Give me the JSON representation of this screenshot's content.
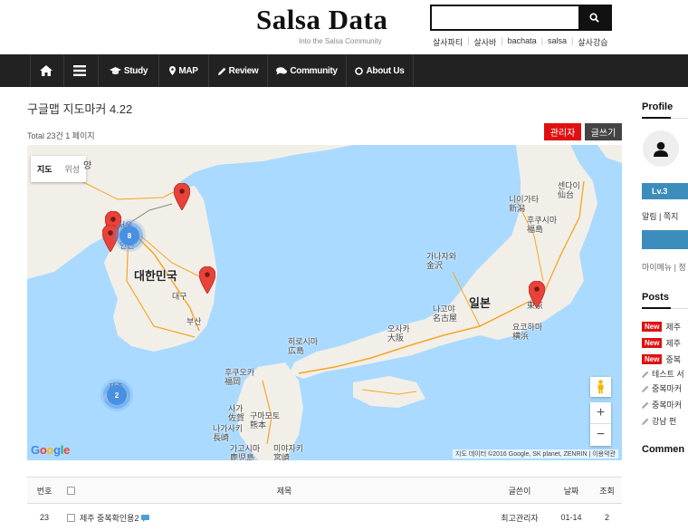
{
  "header": {
    "logo": "Salsa Data",
    "tagline": "Into the Salsa Community",
    "search_placeholder": "",
    "quick_links": [
      "살사파티",
      "살사바",
      "bachata",
      "salsa",
      "살사강습"
    ]
  },
  "nav": {
    "items": [
      {
        "label": "",
        "icon": "home-icon"
      },
      {
        "label": "",
        "icon": "menu-icon"
      },
      {
        "label": "Study",
        "icon": "graduation-cap-icon"
      },
      {
        "label": "MAP",
        "icon": "map-marker-icon"
      },
      {
        "label": "Review",
        "icon": "pencil-icon"
      },
      {
        "label": "Community",
        "icon": "comments-icon"
      },
      {
        "label": "About Us",
        "icon": "circle-icon"
      }
    ]
  },
  "board": {
    "title": "구글맵 지도마커 4.22",
    "total": "Total 23건 1 페이지",
    "admin_button": "관리자",
    "write_button": "글쓰기"
  },
  "map": {
    "type_map": "지도",
    "type_satellite": "위성",
    "labels": {
      "korea": "대한민국",
      "japan": "일본",
      "daegu": "대구",
      "busan": "부산",
      "seoul": "서울",
      "incheon": "인천",
      "jeju": "제주",
      "niigata": "니이가타\n新潟",
      "sendai": "센다이\n仙台",
      "fukushima": "후쿠시마\n福島",
      "kanazawa": "가나자와\n金沢",
      "nagoya": "나고야\n名古屋",
      "osaka": "오사카\n大阪",
      "tokyo": "東京",
      "yokohama": "요코하마\n横浜",
      "hiroshima": "히로시마\n広島",
      "fukuoka": "후쿠오카\n福岡",
      "saga": "사가\n佐賀",
      "kumamoto": "구마모토\n熊本",
      "nagasaki": "나가사키\n長崎",
      "kagoshima": "가고시마\n鹿児島",
      "miyazaki": "미야자키\n宮崎",
      "pyongyang": "양"
    },
    "clusters": [
      {
        "label": "8"
      },
      {
        "label": "2"
      }
    ],
    "attribution": "지도 데이터 ©2016 Google, SK planet, ZENRIN | 이용약관",
    "google_logo": "Google",
    "zoom_in": "+",
    "zoom_out": "−",
    "colors": {
      "sea": "#aadaff",
      "land": "#f2efe9",
      "road": "#f5a623",
      "marker": "#e8423a",
      "cluster": "#4a90e2"
    }
  },
  "table": {
    "headers": {
      "num": "번호",
      "title": "제목",
      "author": "글쓴이",
      "date": "날짜",
      "views": "조회"
    },
    "rows": [
      {
        "num": "23",
        "title": "제주 중복확인용2",
        "author": "최고관리자",
        "date": "01-14",
        "views": "2"
      }
    ]
  },
  "sidebar": {
    "profile_title": "Profile",
    "level": "Lv.3",
    "links": "알림 | 쪽지",
    "my_menu": "마이메뉴 | 정",
    "posts_title": "Posts",
    "posts": [
      {
        "badge": "New",
        "title": "제주"
      },
      {
        "badge": "New",
        "title": "제주"
      },
      {
        "badge": "New",
        "title": "중복"
      },
      {
        "badge": "",
        "title": "테스트 서"
      },
      {
        "badge": "",
        "title": "중복마커"
      },
      {
        "badge": "",
        "title": "중복마커"
      },
      {
        "badge": "",
        "title": "강남 펀"
      }
    ],
    "comments_title": "Commen"
  }
}
